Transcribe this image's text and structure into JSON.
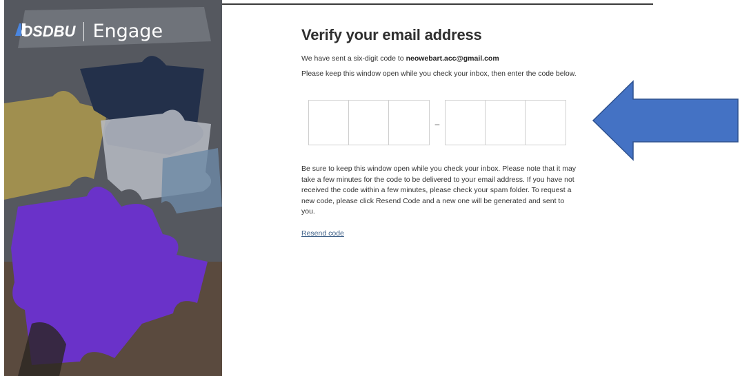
{
  "brand": {
    "left": "OSDBU",
    "right": "Engage"
  },
  "verify": {
    "title": "Verify your email address",
    "sent_prefix": "We have sent a six-digit code to ",
    "email": "neowebart.acc@gmail.com",
    "instructions": "Please keep this window open while you check your inbox, then enter the code below.",
    "separator": "–",
    "note": "Be sure to keep this window open while you check your inbox. Please note that it may take a few minutes for the code to be delivered to your email address. If you have not received the code within a few minutes, please check your spam folder. To request a new code, please click Resend Code and a new one will be generated and sent to you.",
    "resend_label": "Resend code"
  },
  "colors": {
    "arrow_fill": "#4472c4",
    "arrow_stroke": "#2f528f",
    "link": "#3b5e86"
  },
  "icons": {
    "arrow": "left-arrow-icon"
  }
}
